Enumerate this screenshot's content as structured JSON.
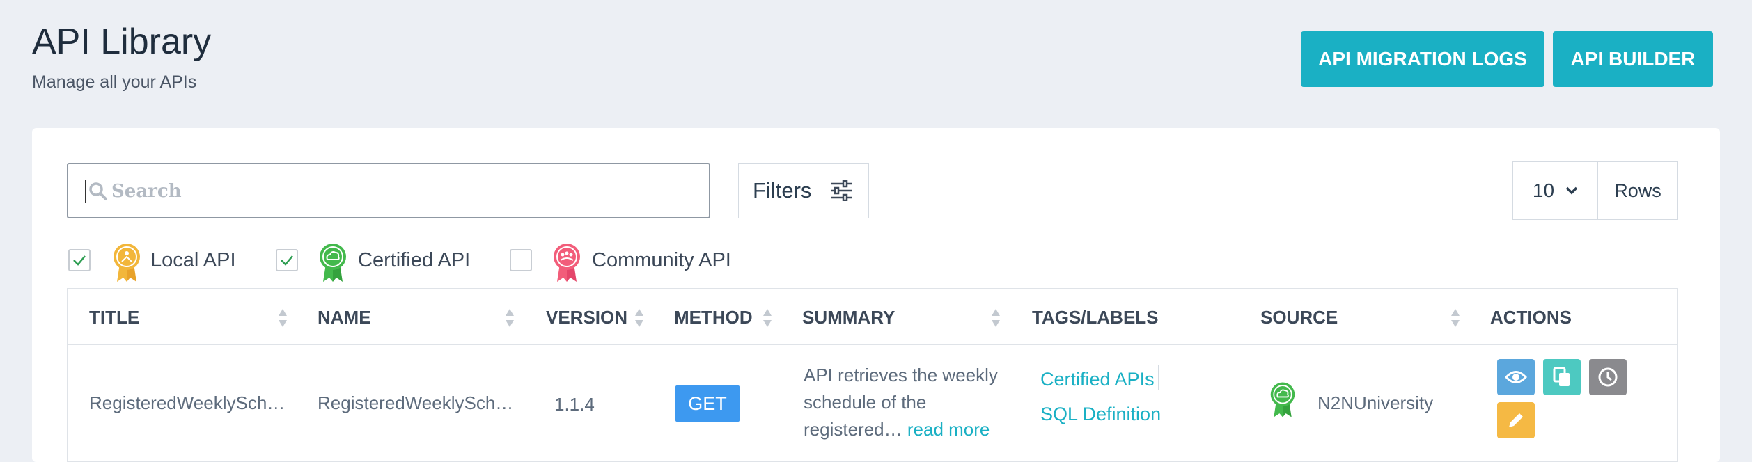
{
  "header": {
    "title": "API Library",
    "subtitle": "Manage all your APIs",
    "buttons": {
      "migration_logs": "API MIGRATION LOGS",
      "builder": "API BUILDER"
    }
  },
  "search": {
    "placeholder": "Search",
    "value": ""
  },
  "filters": {
    "label": "Filters"
  },
  "rows": {
    "value": "10",
    "label": "Rows"
  },
  "legend": [
    {
      "label": "Local API",
      "checked": true,
      "icon": "local-api-badge-icon",
      "color": "#f2b63a"
    },
    {
      "label": "Certified API",
      "checked": true,
      "icon": "certified-api-badge-icon",
      "color": "#43b94c"
    },
    {
      "label": "Community API",
      "checked": false,
      "icon": "community-api-badge-icon",
      "color": "#f25d7a"
    }
  ],
  "table": {
    "columns": [
      "TITLE",
      "NAME",
      "VERSION",
      "METHOD",
      "SUMMARY",
      "TAGS/LABELS",
      "SOURCE",
      "ACTIONS"
    ],
    "rows": [
      {
        "title": "RegisteredWeeklySch…",
        "name": "RegisteredWeeklySch…",
        "version": "1.1.4",
        "method": "GET",
        "summary": "API retrieves the weekly schedule of the registered…",
        "read_more": "read more",
        "tags": [
          "Certified APIs",
          "SQL Definition"
        ],
        "source": "N2NUniversity",
        "source_icon": "certified-api-badge-icon",
        "actions": [
          "view-icon",
          "copy-icon",
          "history-icon",
          "edit-icon"
        ]
      }
    ]
  },
  "colors": {
    "accent": "#1ab0c4",
    "get": "#3d99f0",
    "view": "#5ba7dd",
    "copy": "#4dc9c1",
    "history": "#8a8a8e",
    "edit": "#f5b944"
  }
}
